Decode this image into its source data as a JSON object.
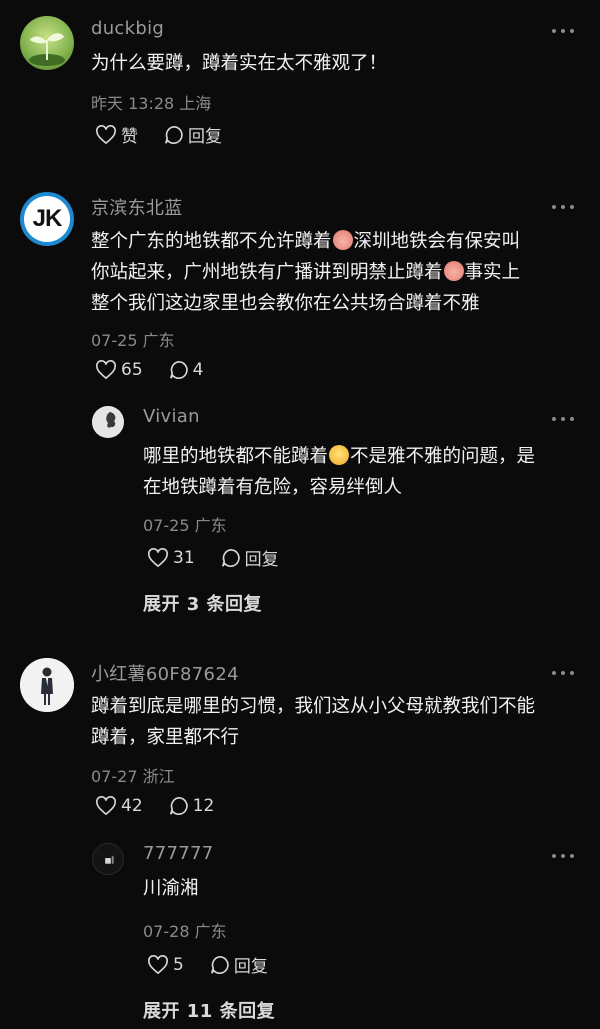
{
  "comments": [
    {
      "user": "duckbig",
      "avatar_icon": "sprout-icon",
      "lines": [
        "为什么要蹲，蹲着实在太不雅观了！"
      ],
      "meta": "昨天 13:28 上海",
      "like_label": "赞",
      "reply_label": "回复"
    },
    {
      "user": "京滨东北蓝",
      "avatar_text": "JK",
      "lines": [
        "整个广东的地铁都不允许蹲着",
        "深圳地铁会有保安叫",
        "你站起来，广州地铁有广播讲到明禁止蹲着",
        "事实上",
        "整个我们这边家里也会教你在公共场合蹲着不雅"
      ],
      "meta": "07-25 广东",
      "likes": "65",
      "replies": "4",
      "reply": {
        "user": "Vivian",
        "avatar_icon": "person-silhouette-icon",
        "lines": [
          "哪里的地铁都不能蹲着",
          "不是雅不雅的问题，是",
          "在地铁蹲着有危险，容易绊倒人"
        ],
        "meta": "07-25 广东",
        "likes": "31",
        "reply_label": "回复"
      },
      "expand_label": "展开 3 条回复"
    },
    {
      "user": "小红薯60F87624",
      "avatar_icon": "standing-man-icon",
      "lines": [
        "蹲着到底是哪里的习惯，我们这从小父母就教我们不能",
        "蹲着，家里都不行"
      ],
      "meta": "07-27 浙江",
      "likes": "42",
      "replies": "12",
      "reply": {
        "user": "777777",
        "avatar_icon": "dark-photo-icon",
        "lines": [
          "川渝湘"
        ],
        "meta": "07-28 广东",
        "likes": "5",
        "reply_label": "回复"
      },
      "expand_label": "展开 11 条回复"
    }
  ],
  "colors": {
    "background": "#0b0b0b",
    "text": "#f1f1f1",
    "muted": "#8a8a8a"
  }
}
